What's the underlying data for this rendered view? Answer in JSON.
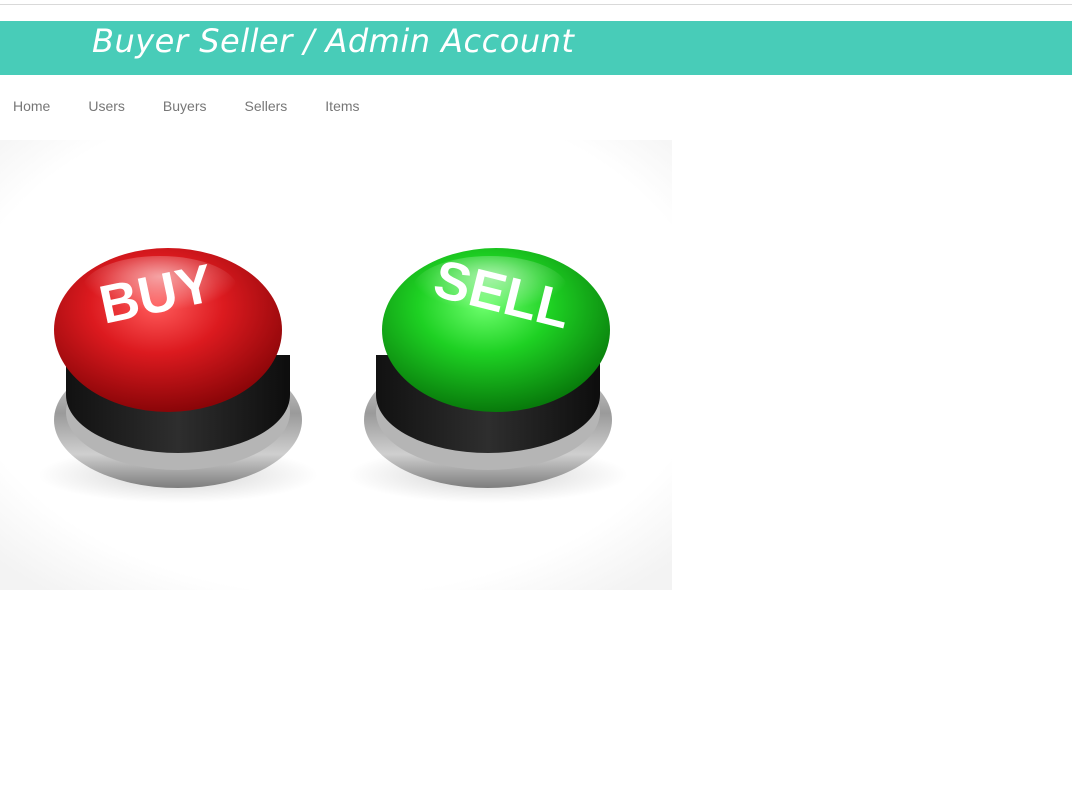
{
  "header": {
    "title": "Buyer Seller / Admin Account",
    "background": "#48ccb8"
  },
  "nav": {
    "items": [
      {
        "label": "Home"
      },
      {
        "label": "Users"
      },
      {
        "label": "Buyers"
      },
      {
        "label": "Sellers"
      },
      {
        "label": "Items"
      }
    ]
  },
  "hero": {
    "buy_label": "BUY",
    "sell_label": "SELL",
    "buy_color": "#d0161b",
    "sell_color": "#19c81e"
  }
}
